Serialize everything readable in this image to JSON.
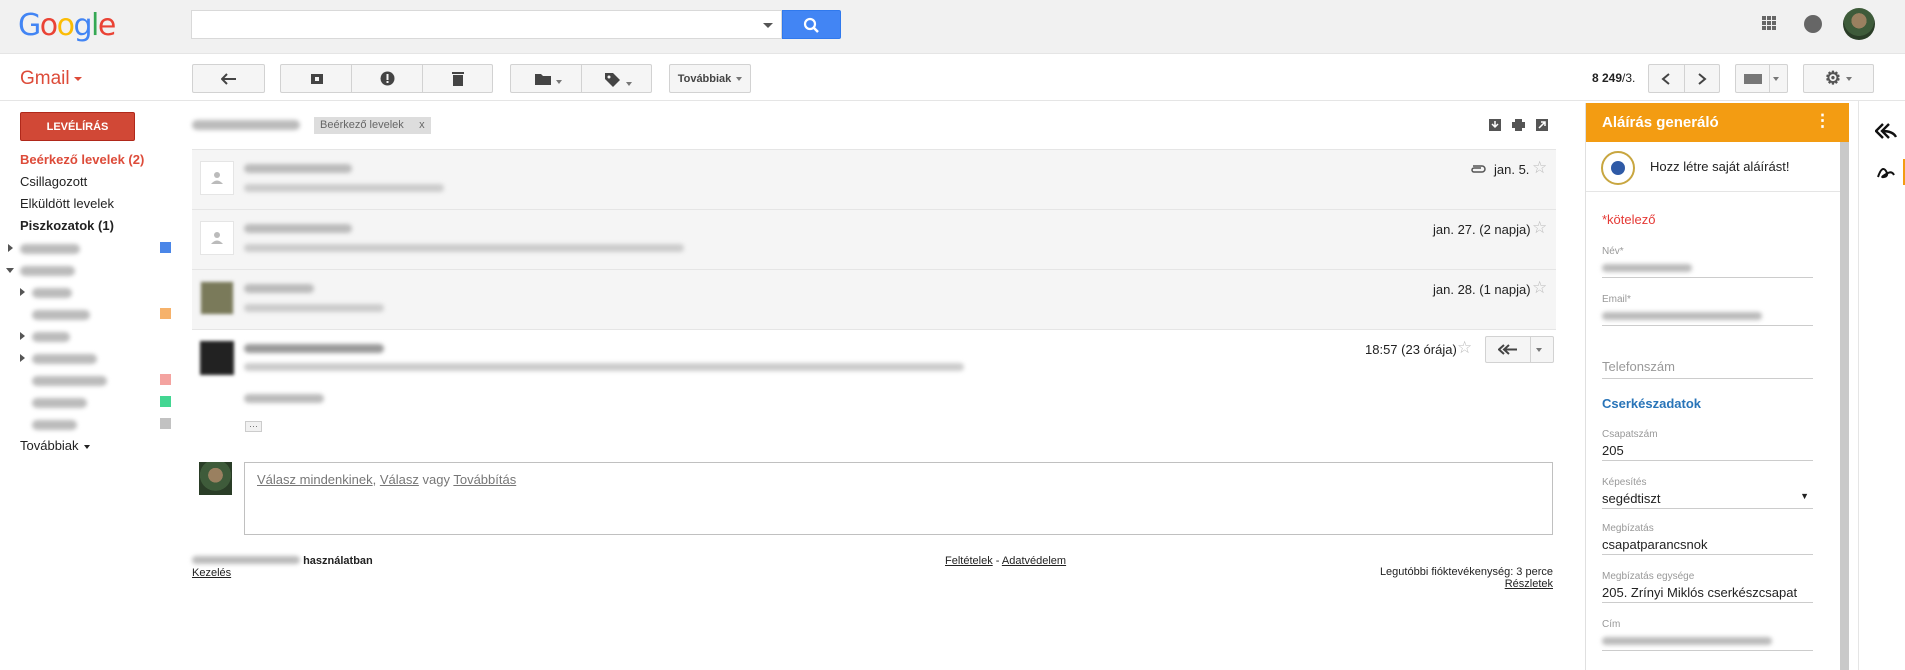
{
  "header": {
    "logo_letters": [
      {
        "ch": "G",
        "color": "#4285f4"
      },
      {
        "ch": "o",
        "color": "#ea4335"
      },
      {
        "ch": "o",
        "color": "#fbbc05"
      },
      {
        "ch": "g",
        "color": "#4285f4"
      },
      {
        "ch": "l",
        "color": "#34a853"
      },
      {
        "ch": "e",
        "color": "#ea4335"
      }
    ],
    "search_placeholder": "",
    "icons": [
      "apps-icon",
      "notifications-icon",
      "account-avatar"
    ]
  },
  "toolbar": {
    "app_name": "Gmail",
    "more_label": "Továbbiak",
    "pager_bold": "8 249",
    "pager_rest": "/3."
  },
  "sidebar": {
    "compose_label": "LEVÉLÍRÁS",
    "items": [
      {
        "label": "Beérkező levelek (2)",
        "state": "active"
      },
      {
        "label": "Csillagozott",
        "state": ""
      },
      {
        "label": "Elküldött levelek",
        "state": ""
      },
      {
        "label": "Piszkozatok (1)",
        "state": "bold"
      }
    ],
    "more_label": "Továbbiak",
    "label_colors": [
      "#4a86e8",
      "#f6b26b",
      "#f4a3a0",
      "#43d692",
      "#c2c2c2"
    ]
  },
  "thread": {
    "tag_label": "Beérkező levelek",
    "tag_close": "x",
    "messages": [
      {
        "date": "jan. 5.",
        "attachment": true
      },
      {
        "date": "jan. 27. (2 napja)",
        "attachment": false
      },
      {
        "date": "jan. 28. (1 napja)",
        "attachment": false
      },
      {
        "date": "18:57 (23 órája)",
        "attachment": false
      }
    ],
    "ellipsis": "···",
    "reply_all": "Válasz mindenkinek",
    "reply_sep": ", ",
    "reply": "Válasz",
    "reply_or": " vagy ",
    "forward": "Továbbítás"
  },
  "footer": {
    "usage_suffix": "használatban",
    "manage": "Kezelés",
    "terms": "Feltételek",
    "dash": " - ",
    "privacy": "Adatvédelem",
    "last_activity": "Legutóbbi fióktevékenység: 3 perce",
    "details": "Részletek"
  },
  "signature_panel": {
    "title": "Aláírás generáló",
    "menu_icon": "⋮",
    "create_text": "Hozz létre saját aláírást!",
    "required": "*kötelező",
    "name_label": "Név*",
    "email_label": "Email*",
    "phone_label": "Telefonszám",
    "scout_section": "Cserkészadatok",
    "team_no_label": "Csapatszám",
    "team_no_value": "205",
    "qualification_label": "Képesítés",
    "qualification_value": "segédtiszt",
    "role_label": "Megbízatás",
    "role_value": "csapatparancsnok",
    "role_unit_label": "Megbízatás egysége",
    "role_unit_value": "205. Zrínyi Miklós cserkészcsapat",
    "address_label": "Cím"
  }
}
